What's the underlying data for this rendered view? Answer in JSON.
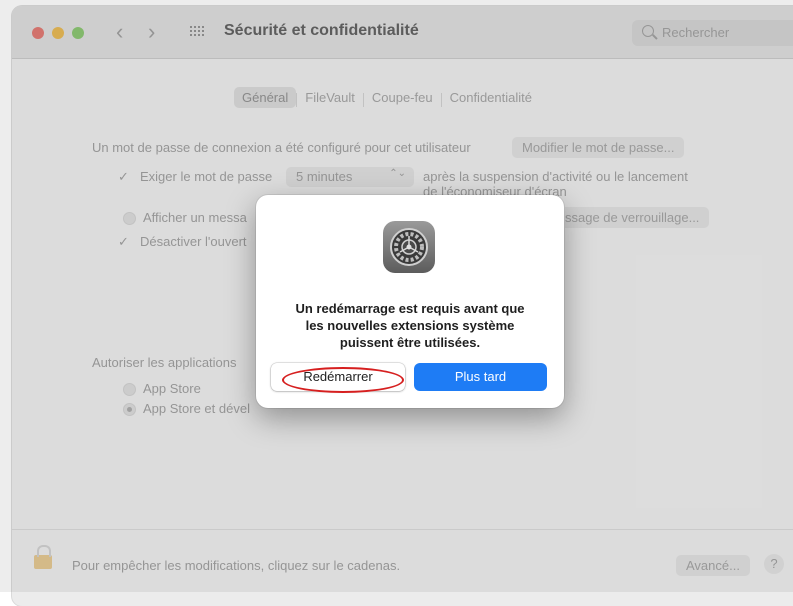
{
  "window": {
    "title": "Sécurité et confidentialité",
    "search_placeholder": "Rechercher",
    "nav_back": "‹",
    "nav_forward": "›"
  },
  "tabs": [
    "Général",
    "FileVault",
    "Coupe-feu",
    "Confidentialité"
  ],
  "general": {
    "password_set_text": "Un mot de passe de connexion a été configuré pour cet utilisateur",
    "change_password_button": "Modifier le mot de passe...",
    "require_password_label": "Exiger le mot de passe",
    "require_password_checked": true,
    "require_password_value": "5 minutes",
    "after_sleep_line1": "après la suspension d'activité ou le lancement",
    "after_sleep_line2": "de l'économiseur d'écran",
    "show_message_label": "Afficher un messa",
    "lock_message_button": "ssage de verrouillage...",
    "disable_autologin_label": "Désactiver l'ouvert",
    "allow_apps_label": "Autoriser les applications",
    "option_app_store": "App Store",
    "option_app_store_devs": "App Store et dével",
    "option_selected": "App Store et développeurs identifiés"
  },
  "footer": {
    "lock_text": "Pour empêcher les modifications, cliquez sur le cadenas.",
    "advanced_button": "Avancé...",
    "help_button": "?"
  },
  "dialog": {
    "icon": "system-preferences-gear-icon",
    "message": "Un redémarrage est requis avant que\nles nouvelles extensions système\npuissent être utilisées.",
    "restart_button": "Redémarrer",
    "later_button": "Plus tard",
    "highlight_color": "#d61f1f",
    "primary_color": "#1e7cf5"
  }
}
